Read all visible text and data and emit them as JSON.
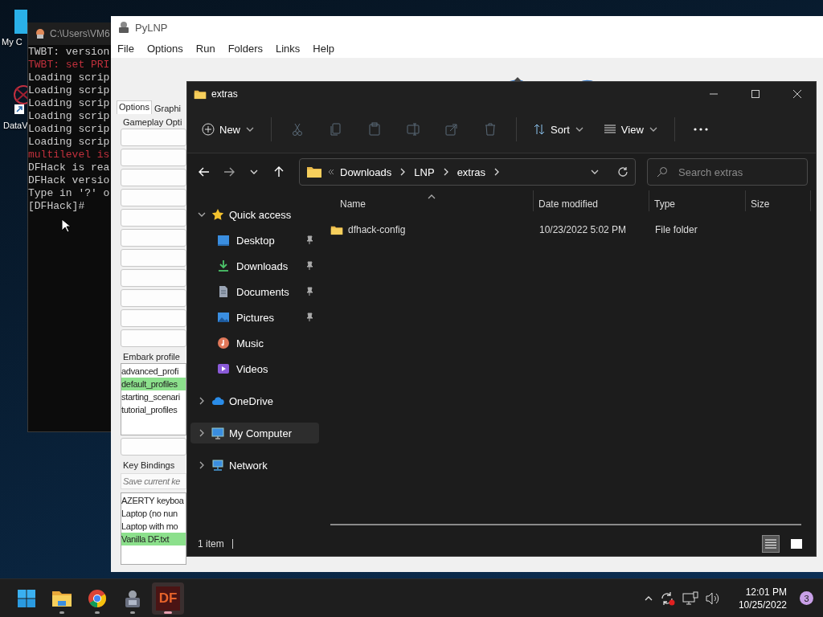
{
  "desktop": {
    "icons": [
      {
        "label": "My C"
      },
      {
        "label": "DataV"
      }
    ]
  },
  "console": {
    "title": "C:\\Users\\VM6",
    "lines": [
      {
        "text": "TWBT: version",
        "color": "#cccccc"
      },
      {
        "text": "TWBT: set PRI",
        "color": "#c0303c"
      },
      {
        "text": "Loading scrip",
        "color": "#cccccc"
      },
      {
        "text": "Loading scrip",
        "color": "#cccccc"
      },
      {
        "text": "Loading scrip",
        "color": "#cccccc"
      },
      {
        "text": "Loading scrip",
        "color": "#cccccc"
      },
      {
        "text": "Loading scrip",
        "color": "#cccccc"
      },
      {
        "text": "Loading scrip",
        "color": "#cccccc"
      },
      {
        "text": "multilevel is",
        "color": "#c0303c"
      },
      {
        "text": "DFHack is rea",
        "color": "#cccccc"
      },
      {
        "text": "DFHack versio",
        "color": "#cccccc"
      },
      {
        "text": "Type in '?' o",
        "color": "#cccccc"
      },
      {
        "text": "[DFHack]#",
        "color": "#cccccc"
      }
    ]
  },
  "pylnp": {
    "title": "PyLNP",
    "menu": [
      "File",
      "Options",
      "Run",
      "Folders",
      "Links",
      "Help"
    ],
    "tabs": [
      {
        "label": "Options",
        "selected": true
      },
      {
        "label": "Graphi",
        "selected": false
      }
    ],
    "gameplay": {
      "title": "Gameplay Opti",
      "buttons": [
        {
          "kind": "button"
        },
        {
          "kind": "button"
        },
        {
          "kind": "button"
        },
        {
          "kind": "button"
        },
        {
          "kind": "button"
        },
        {
          "kind": "button"
        },
        {
          "kind": "button"
        },
        {
          "kind": "button"
        },
        {
          "kind": "button"
        },
        {
          "kind": "button"
        },
        {
          "kind": "button"
        }
      ]
    },
    "embark": {
      "title": "Embark profile",
      "items": [
        {
          "label": "advanced_profi",
          "selected": false
        },
        {
          "label": "default_profiles",
          "selected": true
        },
        {
          "label": "starting_scenari",
          "selected": false
        },
        {
          "label": "tutorial_profiles",
          "selected": false
        }
      ]
    },
    "keybindings": {
      "title": "Key Bindings",
      "placeholder": "Save current ke",
      "items": [
        {
          "label": "AZERTY keyboa",
          "selected": false
        },
        {
          "label": "Laptop (no nun",
          "selected": false
        },
        {
          "label": "Laptop with mo",
          "selected": false
        },
        {
          "label": "Vanilla DF.txt",
          "selected": true
        }
      ]
    }
  },
  "explorer": {
    "title": "extras",
    "toolbar": [
      {
        "kind": "menu",
        "label": "New"
      },
      {
        "kind": "icon",
        "disabled": true
      },
      {
        "kind": "icon",
        "disabled": true
      },
      {
        "kind": "icon",
        "disabled": true
      },
      {
        "kind": "icon",
        "disabled": true
      },
      {
        "kind": "icon",
        "disabled": true
      },
      {
        "kind": "icon",
        "disabled": true
      },
      {
        "kind": "menu",
        "label": "Sort"
      },
      {
        "kind": "menu",
        "label": "View"
      },
      {
        "kind": "more"
      }
    ],
    "breadcrumbs": [
      "Downloads",
      "LNP",
      "extras"
    ],
    "search": {
      "placeholder": "Search extras"
    },
    "nav": [
      {
        "label": "Quick access",
        "expanded": true,
        "selected": false,
        "children": [
          {
            "label": "Desktop",
            "pinned": true,
            "selected": false
          },
          {
            "label": "Downloads",
            "pinned": true,
            "selected": false
          },
          {
            "label": "Documents",
            "pinned": true,
            "selected": false
          },
          {
            "label": "Pictures",
            "pinned": true,
            "selected": false
          },
          {
            "label": "Music",
            "pinned": false,
            "selected": false
          },
          {
            "label": "Videos",
            "pinned": false,
            "selected": false
          }
        ]
      },
      {
        "label": "OneDrive",
        "expanded": false,
        "selected": false
      },
      {
        "label": "My Computer",
        "expanded": false,
        "selected": true
      },
      {
        "label": "Network",
        "expanded": false,
        "selected": false
      }
    ],
    "columns": [
      {
        "label": "Name",
        "sorted": true
      },
      {
        "label": "Date modified",
        "sorted": false
      },
      {
        "label": "Type",
        "sorted": false
      },
      {
        "label": "Size",
        "sorted": false
      }
    ],
    "rows": [
      {
        "name": "dfhack-config",
        "date": "10/23/2022 5:02 PM",
        "type": "File folder"
      }
    ],
    "status": "1 item",
    "views": [
      {
        "kind": "details",
        "selected": true
      },
      {
        "kind": "tiles",
        "selected": false
      }
    ]
  },
  "taskbar": {
    "apps": [
      {
        "kind": "start",
        "running": false,
        "active": false
      },
      {
        "kind": "folder",
        "running": true,
        "active": false
      },
      {
        "kind": "browser",
        "running": true,
        "active": false
      },
      {
        "kind": "lnp",
        "running": true,
        "active": false
      },
      {
        "kind": "df",
        "label": "DF",
        "running": true,
        "active": true
      }
    ],
    "time": "12:01 PM",
    "date": "10/25/2022",
    "badge": "3"
  }
}
